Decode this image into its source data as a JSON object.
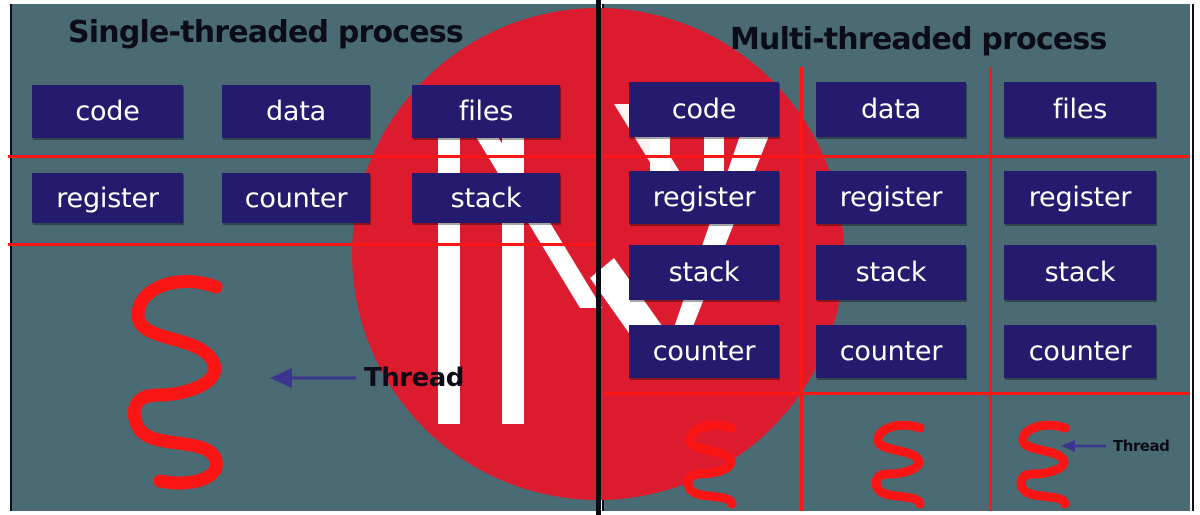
{
  "diagram": {
    "title_left": "Single-threaded process",
    "title_right": "Multi-threaded process",
    "colors": {
      "background": "#4a6b73",
      "box": "#241b6e",
      "box_text": "#ffffff",
      "grid_line": "#fc1616",
      "circle": "#dd1b2e",
      "watermark": "#ffffff",
      "heading_text": "#0c0c18",
      "arrow": "#3b358f",
      "divider": "#0a0a14"
    }
  },
  "left_process": {
    "heading": "Single-threaded process",
    "row1": [
      "code",
      "data",
      "files"
    ],
    "row2": [
      "register",
      "counter",
      "stack"
    ],
    "thread_label": "Thread"
  },
  "right_process": {
    "heading": "Multi-threaded process",
    "row1": [
      "code",
      "data",
      "files"
    ],
    "row2": [
      "register",
      "register",
      "register"
    ],
    "row3": [
      "stack",
      "stack",
      "stack"
    ],
    "row4": [
      "counter",
      "counter",
      "counter"
    ],
    "thread_label": "Thread"
  },
  "icons": {
    "arrow": "left-arrow-icon",
    "squiggle": "thread-squiggle-icon",
    "watermark": "watermark-logo-icon"
  }
}
